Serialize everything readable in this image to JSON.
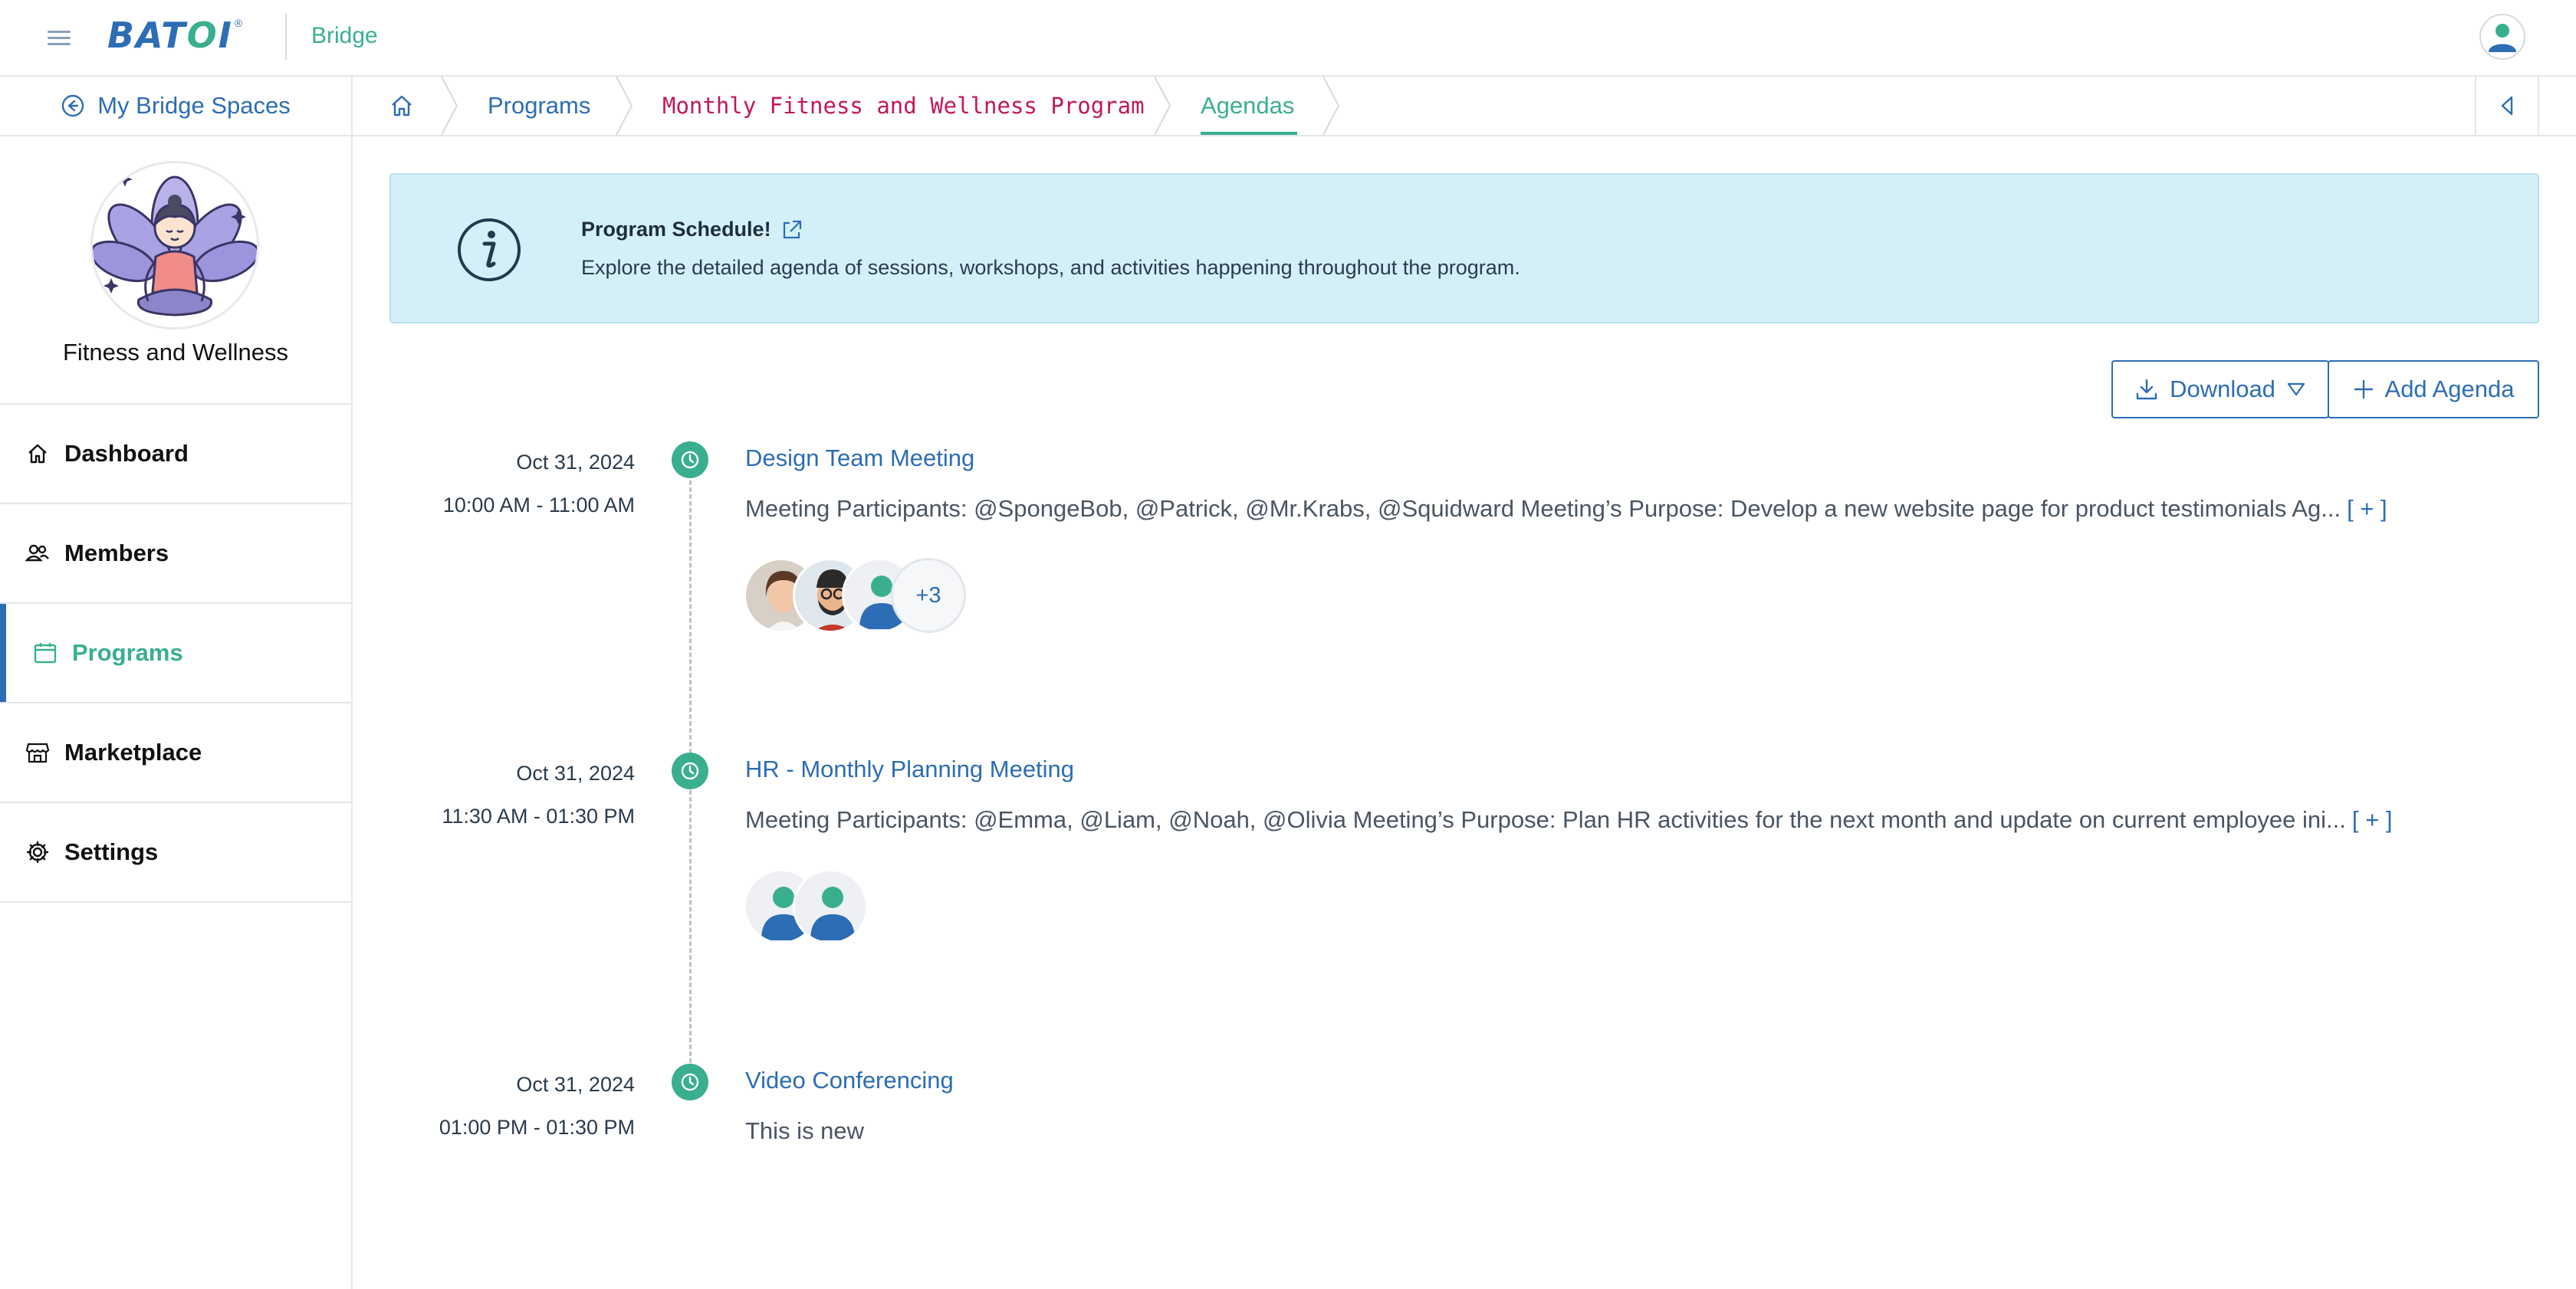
{
  "header": {
    "logo_text": "BATOI",
    "logo_registered": "®",
    "app_name": "Bridge",
    "menu_icon": "hamburger-icon",
    "user_icon": "user-avatar-icon"
  },
  "sidebar": {
    "back_label": "My Bridge Spaces",
    "space_name": "Fitness and Wellness",
    "items": [
      {
        "label": "Dashboard",
        "icon": "home-icon"
      },
      {
        "label": "Members",
        "icon": "members-icon"
      },
      {
        "label": "Programs",
        "icon": "calendar-icon",
        "active": true
      },
      {
        "label": "Marketplace",
        "icon": "store-icon"
      },
      {
        "label": "Settings",
        "icon": "gear-icon"
      }
    ]
  },
  "breadcrumb": {
    "home_icon": "home-icon",
    "items": [
      "Programs",
      "Monthly Fitness and Wellness Program",
      "Agendas"
    ]
  },
  "banner": {
    "title": "Program Schedule!",
    "text": "Explore the detailed agenda of sessions, workshops, and activities happening throughout the program."
  },
  "actions": {
    "download_label": "Download",
    "add_label": "Add Agenda"
  },
  "agendas": [
    {
      "date": "Oct 31, 2024",
      "time": "10:00 AM - 11:00 AM",
      "title": "Design Team Meeting",
      "description": "Meeting Participants: @SpongeBob, @Patrick, @Mr.Krabs, @Squidward Meeting’s Purpose: Develop a new website page for product testimonials Ag...",
      "more": "[ + ]",
      "extra_count": "+3"
    },
    {
      "date": "Oct 31, 2024",
      "time": "11:30 AM - 01:30 PM",
      "title": "HR - Monthly Planning Meeting",
      "description": "Meeting Participants: @Emma, @Liam, @Noah, @Olivia Meeting’s Purpose: Plan HR activities for the next month and update on current employee ini...",
      "more": "[ + ]"
    },
    {
      "date": "Oct 31, 2024",
      "time": "01:00 PM - 01:30 PM",
      "title": "Video Conferencing",
      "description": "This is new"
    }
  ],
  "colors": {
    "brand_blue": "#2d6db5",
    "brand_green": "#3aaf8f",
    "banner_bg": "#d3f0f8",
    "breadcrumb_mono": "#c2185b"
  }
}
